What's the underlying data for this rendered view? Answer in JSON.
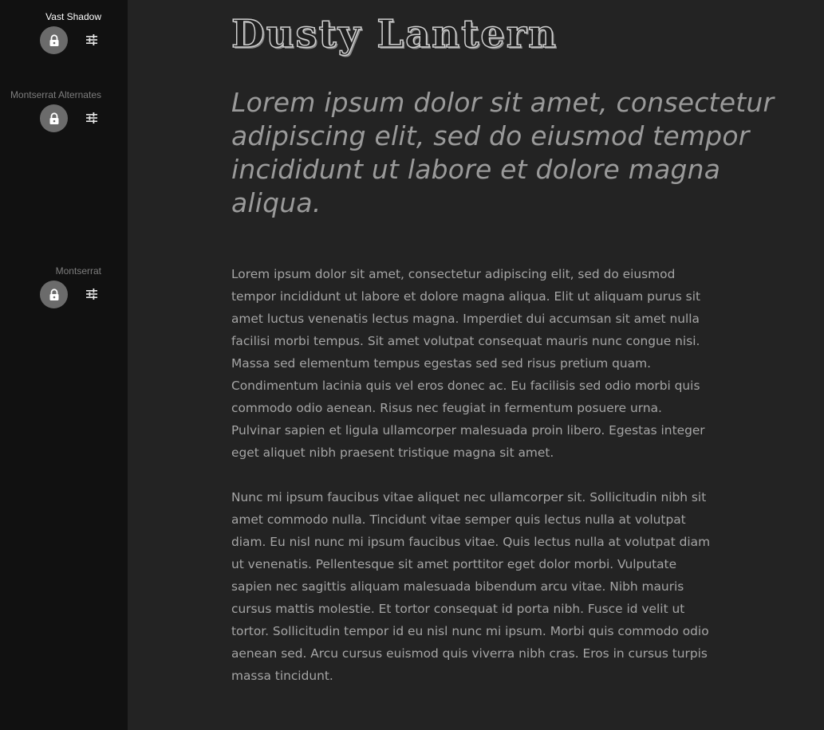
{
  "sidebar": {
    "fonts": [
      {
        "name": "Vast Shadow",
        "active": true,
        "lock_icon": "lock-icon",
        "settings_icon": "tune-icon"
      },
      {
        "name": "Montserrat Alternates",
        "active": false,
        "lock_icon": "lock-icon",
        "settings_icon": "tune-icon"
      },
      {
        "name": "Montserrat",
        "active": false,
        "lock_icon": "lock-icon",
        "settings_icon": "tune-icon"
      }
    ]
  },
  "preview": {
    "title": "Dusty Lantern",
    "subtitle": "Lorem ipsum dolor sit amet, consectetur adipiscing elit, sed do eiusmod tempor incididunt ut labore et dolore magna aliqua.",
    "paragraphs": [
      "Lorem ipsum dolor sit amet, consectetur adipiscing elit, sed do eiusmod tempor incididunt ut labore et dolore magna aliqua. Elit ut aliquam purus sit amet luctus venenatis lectus magna. Imperdiet dui accumsan sit amet nulla facilisi morbi tempus. Sit amet volutpat consequat mauris nunc congue nisi. Massa sed elementum tempus egestas sed sed risus pretium quam. Condimentum lacinia quis vel eros donec ac. Eu facilisis sed odio morbi quis commodo odio aenean. Risus nec feugiat in fermentum posuere urna. Pulvinar sapien et ligula ullamcorper malesuada proin libero. Egestas integer eget aliquet nibh praesent tristique magna sit amet.",
      "Nunc mi ipsum faucibus vitae aliquet nec ullamcorper sit. Sollicitudin nibh sit amet commodo nulla. Tincidunt vitae semper quis lectus nulla at volutpat diam. Eu nisl nunc mi ipsum faucibus vitae. Quis lectus nulla at volutpat diam ut venenatis. Pellentesque sit amet porttitor eget dolor morbi. Vulputate sapien nec sagittis aliquam malesuada bibendum arcu vitae. Nibh mauris cursus mattis molestie. Et tortor consequat id porta nibh. Fusce id velit ut tortor. Sollicitudin tempor id eu nisl nunc mi ipsum. Morbi quis commodo odio aenean sed. Arcu cursus euismod quis viverra nibh cras. Eros in cursus turpis massa tincidunt."
    ]
  },
  "colors": {
    "sidebar_bg": "#111111",
    "main_bg": "#232323",
    "lock_button_bg": "#6b6b6b",
    "active_label": "#ffffff",
    "inactive_label": "#7d7d7d"
  }
}
